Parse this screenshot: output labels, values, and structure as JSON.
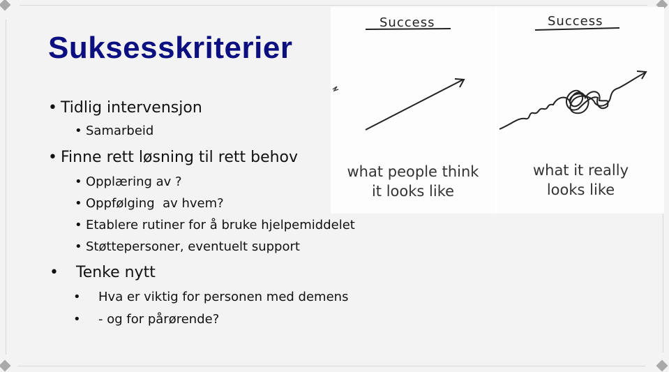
{
  "slide": {
    "title": "Suksesskriterier",
    "title_color": "#0b0f80",
    "bullets": [
      {
        "level": 1,
        "text": "Tidlig intervensjon"
      },
      {
        "level": 2,
        "text": "Samarbeid"
      },
      {
        "level": 1,
        "text": "Finne rett løsning til rett behov"
      },
      {
        "level": 2,
        "text": "Opplæring av ?"
      },
      {
        "level": 2,
        "text": "Oppfølging  av hvem?"
      },
      {
        "level": 2,
        "text": "Etablere rutiner for å bruke hjelpemiddelet"
      },
      {
        "level": 2,
        "text": "Støttepersoner, eventuelt support"
      },
      {
        "level": 1,
        "text": "Tenke nytt"
      },
      {
        "level": 2,
        "text": "Hva er viktig for personen med demens"
      },
      {
        "level": 2,
        "text": "- og for pårørende?"
      }
    ],
    "bullet_glyph": "•"
  },
  "picture": {
    "left_panel": {
      "heading": "Success",
      "caption_line1": "what people think",
      "caption_line2": "it looks like"
    },
    "right_panel": {
      "heading": "Success",
      "caption_line1": "what it really",
      "caption_line2": "looks like"
    }
  }
}
